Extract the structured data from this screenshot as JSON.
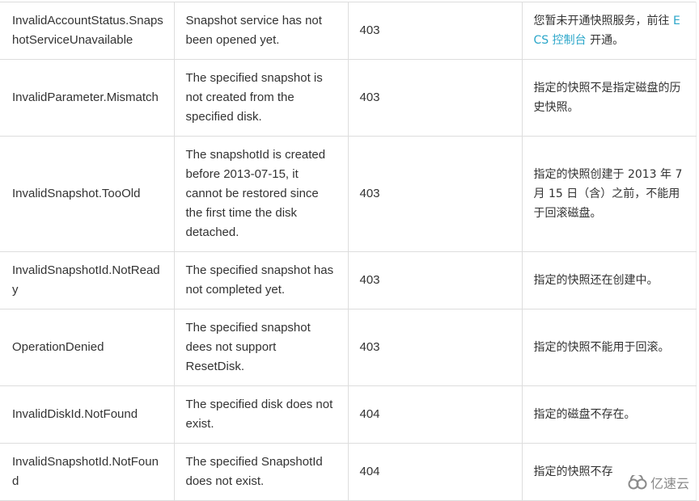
{
  "table": {
    "rows": [
      {
        "code": "InvalidAccountStatus.SnapshotServiceUnavailable",
        "description": "Snapshot service has not been opened yet.",
        "status": "403",
        "message_cn_before": "您暂未开通快照服务，前往 ",
        "message_cn_link": "ECS 控制台",
        "message_cn_after": " 开通。"
      },
      {
        "code": "InvalidParameter.Mismatch",
        "description": "The specified snapshot is not created from the specified disk.",
        "status": "403",
        "message_cn": "指定的快照不是指定磁盘的历史快照。"
      },
      {
        "code": "InvalidSnapshot.TooOld",
        "description": "The snapshotId is created before 2013-07-15, it cannot be restored since the first time the disk detached.",
        "status": "403",
        "message_cn": "指定的快照创建于 2013 年 7 月 15 日（含）之前，不能用于回滚磁盘。"
      },
      {
        "code": "InvalidSnapshotId.NotReady",
        "description": "The specified snapshot has not completed yet.",
        "status": "403",
        "message_cn": "指定的快照还在创建中。"
      },
      {
        "code": "OperationDenied",
        "description": "The specified snapshot dees not support ResetDisk.",
        "status": "403",
        "message_cn": "指定的快照不能用于回滚。"
      },
      {
        "code": "InvalidDiskId.NotFound",
        "description": "The specified disk does not exist.",
        "status": "404",
        "message_cn": "指定的磁盘不存在。"
      },
      {
        "code": "InvalidSnapshotId.NotFound",
        "description": "The specified SnapshotId does not exist.",
        "status": "404",
        "message_cn": "指定的快照不存"
      }
    ]
  },
  "watermark": {
    "icon": "cloud-logo-icon",
    "text": "亿速云"
  },
  "colors": {
    "link": "#2aa6c9",
    "text": "#333333",
    "border": "#dddddd"
  }
}
